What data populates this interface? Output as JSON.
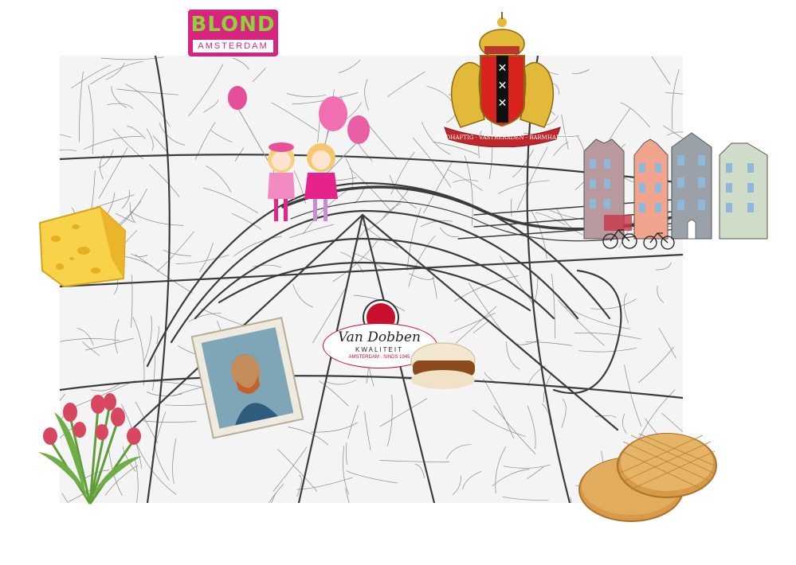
{
  "logo": {
    "line1": "BLOND",
    "line2": "AMSTERDAM",
    "colors": {
      "bg": "#d6247f",
      "text": "#8fd13a"
    }
  },
  "coat_of_arms": {
    "motto": "HELDHAFTIG · VASTBERADEN · BARMHARTIG",
    "colors": {
      "shield": "#d9231e",
      "gold": "#e3b93a"
    }
  },
  "van_dobben": {
    "brand": "Van Dobben",
    "sub": "KWALITEIT",
    "city_line": "AMSTERDAM · SINDS 1945",
    "colors": {
      "red": "#c8102e"
    }
  },
  "stickers": [
    "cheese-icon",
    "tulips-icon",
    "van-gogh-portrait-icon",
    "croquette-icon",
    "stroopwafel-icon",
    "canal-houses-icon",
    "bicycle-icon",
    "balloons-girls-icon"
  ],
  "map": {
    "style": "monochrome street map",
    "stroke": "#3c3c3c"
  }
}
